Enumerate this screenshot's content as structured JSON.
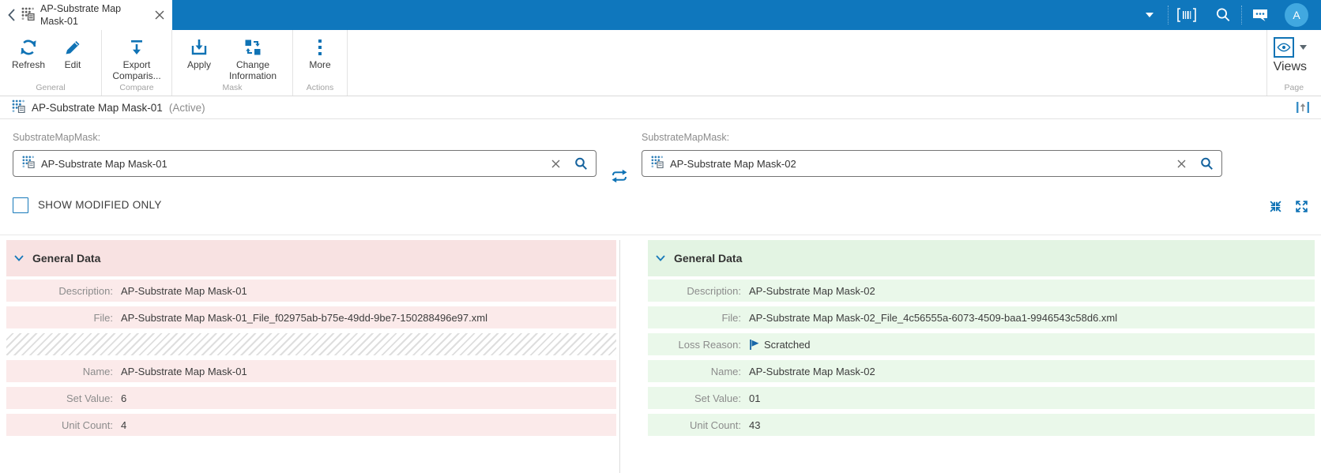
{
  "topbar": {
    "tab_title": "AP-Substrate Map Mask-01",
    "avatar_initial": "A",
    "icons": [
      "chevron-down-icon",
      "barcode-icon",
      "search-icon",
      "chat-icon",
      "avatar"
    ]
  },
  "toolbar": {
    "buttons": {
      "refresh": "Refresh",
      "edit": "Edit",
      "export_comparison": "Export Comparis...",
      "apply": "Apply",
      "change_information": "Change Information",
      "more": "More",
      "views": "Views"
    },
    "groups": {
      "general": "General",
      "compare": "Compare",
      "mask": "Mask",
      "actions": "Actions",
      "page": "Page"
    }
  },
  "entity_header": {
    "title": "AP-Substrate Map Mask-01",
    "status": "(Active)"
  },
  "selectors": {
    "left": {
      "label": "SubstrateMapMask:",
      "value": "AP-Substrate Map Mask-01"
    },
    "right": {
      "label": "SubstrateMapMask:",
      "value": "AP-Substrate Map Mask-02"
    }
  },
  "options": {
    "show_modified_label": "SHOW MODIFIED ONLY"
  },
  "panels": {
    "left": {
      "section_title": "General Data",
      "rows": [
        {
          "label": "Description:",
          "value": "AP-Substrate Map Mask-01"
        },
        {
          "label": "File:",
          "value": "AP-Substrate Map Mask-01_File_f02975ab-b75e-49dd-9be7-150288496e97.xml"
        },
        {
          "label": "",
          "value": "",
          "missing": true
        },
        {
          "label": "Name:",
          "value": "AP-Substrate Map Mask-01"
        },
        {
          "label": "Set Value:",
          "value": "6"
        },
        {
          "label": "Unit Count:",
          "value": "4"
        }
      ]
    },
    "right": {
      "section_title": "General Data",
      "rows": [
        {
          "label": "Description:",
          "value": "AP-Substrate Map Mask-02"
        },
        {
          "label": "File:",
          "value": "AP-Substrate Map Mask-02_File_4c56555a-6073-4509-baa1-9946543c58d6.xml"
        },
        {
          "label": "Loss Reason:",
          "value": "Scratched",
          "link": true
        },
        {
          "label": "Name:",
          "value": "AP-Substrate Map Mask-02"
        },
        {
          "label": "Set Value:",
          "value": "01"
        },
        {
          "label": "Unit Count:",
          "value": "43"
        }
      ]
    }
  },
  "colors": {
    "topbar_blue": "#0F77BD",
    "accent_blue": "#1073B5",
    "link_blue": "#1872B0",
    "removed_header_bg": "#F8E2E2",
    "removed_row_bg": "#FBEAEA",
    "added_header_bg": "#E3F4E3",
    "added_row_bg": "#EAF8EA"
  }
}
